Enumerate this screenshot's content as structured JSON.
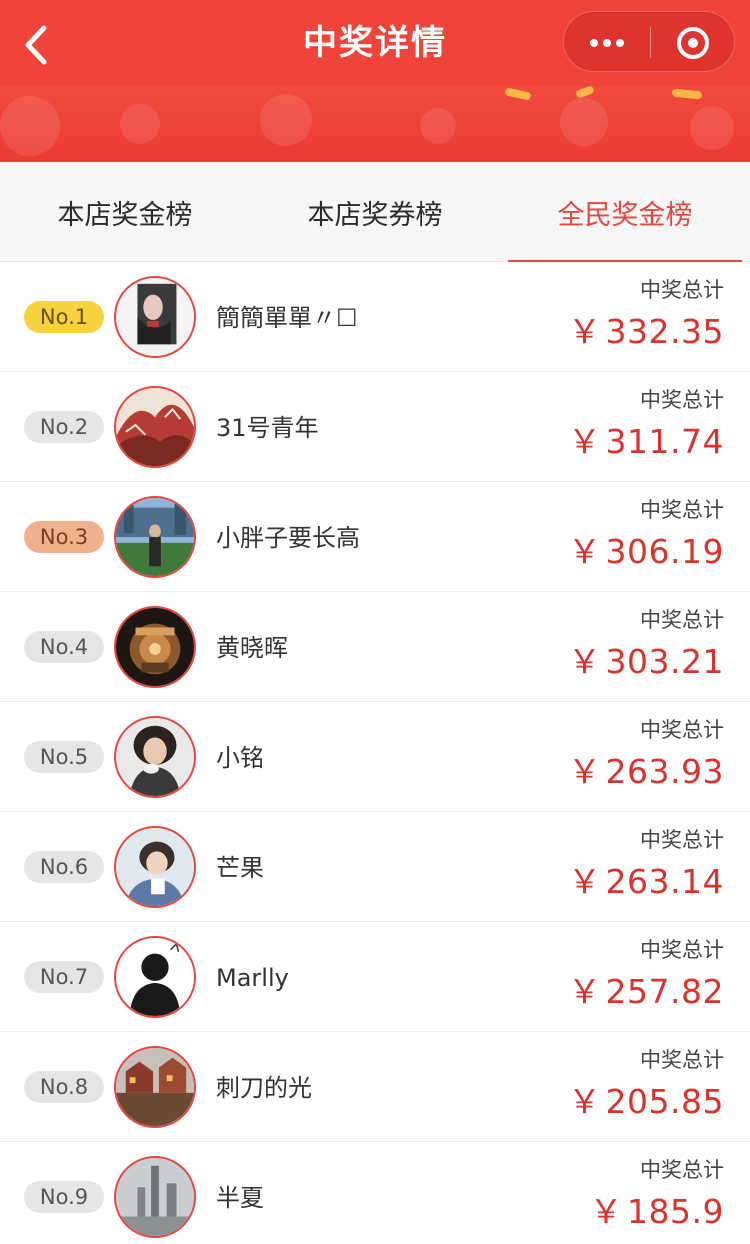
{
  "header": {
    "title": "中奖详情",
    "back_icon": "chevron-left-icon",
    "more_icon": "more-dots-icon",
    "close_icon": "target-close-icon"
  },
  "colors": {
    "header": "#f0433a",
    "accent": "#e8453c",
    "amount": "#d9332b",
    "rank_gold": "#f7d23e",
    "rank_bronze": "#f0b08c",
    "rank_default": "#e5e5e5"
  },
  "tabs": [
    {
      "label": "本店奖金榜",
      "active": false
    },
    {
      "label": "本店奖券榜",
      "active": false
    },
    {
      "label": "全民奖金榜",
      "active": true
    }
  ],
  "leaderboard": {
    "sum_label": "中奖总计",
    "currency": "￥",
    "rows": [
      {
        "rank": "No.1",
        "name": "簡簡單單〃☐",
        "amount": "332.35"
      },
      {
        "rank": "No.2",
        "name": "31号青年",
        "amount": "311.74"
      },
      {
        "rank": "No.3",
        "name": "小胖子要长高",
        "amount": "306.19"
      },
      {
        "rank": "No.4",
        "name": "黄晓晖",
        "amount": "303.21"
      },
      {
        "rank": "No.5",
        "name": "小铭",
        "amount": "263.93"
      },
      {
        "rank": "No.6",
        "name": "芒果",
        "amount": "263.14"
      },
      {
        "rank": "No.7",
        "name": "Marlly",
        "amount": "257.82"
      },
      {
        "rank": "No.8",
        "name": "刺刀的光",
        "amount": "205.85"
      },
      {
        "rank": "No.9",
        "name": "半夏",
        "amount": "185.9"
      }
    ]
  }
}
